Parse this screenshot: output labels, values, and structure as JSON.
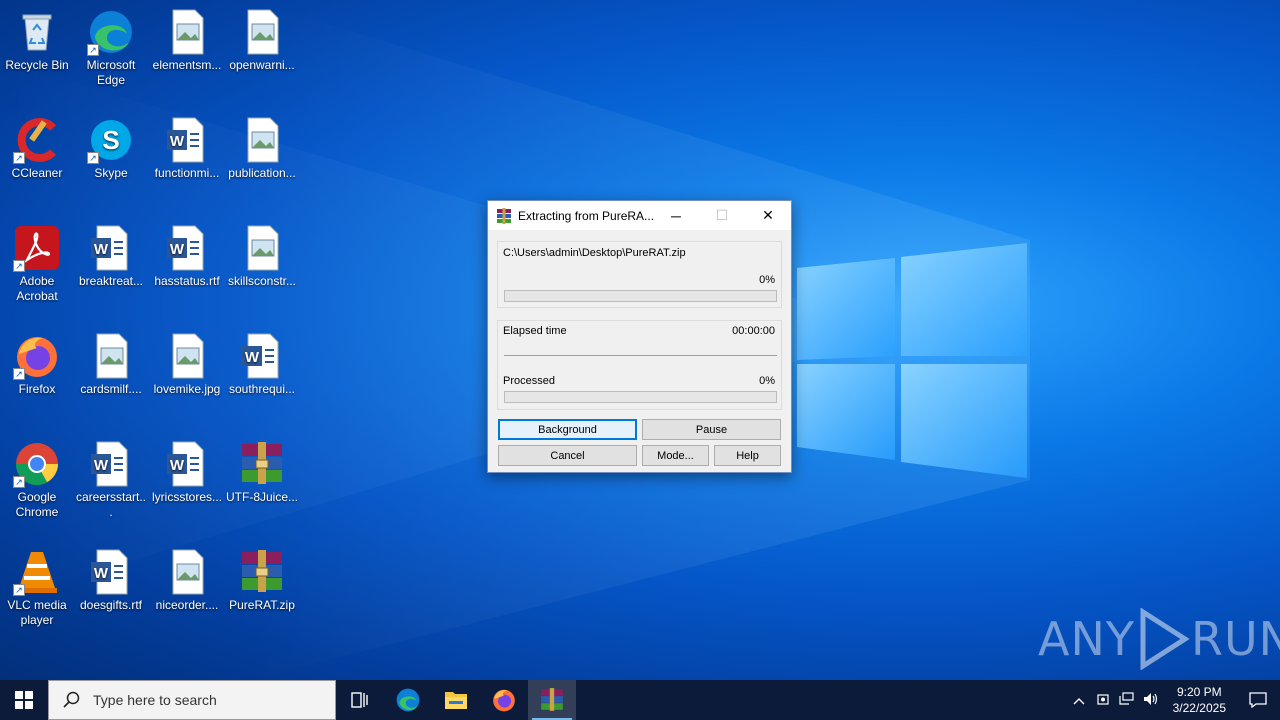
{
  "desktop": {
    "icons": [
      {
        "label": "Recycle Bin",
        "icon": "recycle-bin-icon"
      },
      {
        "label": "Microsoft Edge",
        "icon": "edge-icon"
      },
      {
        "label": "elementsm...",
        "icon": "image-file-icon"
      },
      {
        "label": "openwarni...",
        "icon": "image-file-icon"
      },
      {
        "label": "CCleaner",
        "icon": "ccleaner-icon"
      },
      {
        "label": "Skype",
        "icon": "skype-icon"
      },
      {
        "label": "functionmi...",
        "icon": "word-file-icon"
      },
      {
        "label": "publication...",
        "icon": "image-file-icon"
      },
      {
        "label": "Adobe Acrobat",
        "icon": "acrobat-icon"
      },
      {
        "label": "breaktreat...",
        "icon": "word-file-icon"
      },
      {
        "label": "hasstatus.rtf",
        "icon": "word-file-icon"
      },
      {
        "label": "skillsconstr...",
        "icon": "image-file-icon"
      },
      {
        "label": "Firefox",
        "icon": "firefox-icon"
      },
      {
        "label": "cardsmilf....",
        "icon": "image-file-icon"
      },
      {
        "label": "lovemike.jpg",
        "icon": "image-file-icon"
      },
      {
        "label": "southrequi...",
        "icon": "word-file-icon"
      },
      {
        "label": "Google Chrome",
        "icon": "chrome-icon"
      },
      {
        "label": "careersstart...",
        "icon": "word-file-icon"
      },
      {
        "label": "lyricsstores...",
        "icon": "word-file-icon"
      },
      {
        "label": "UTF-8Juice...",
        "icon": "winrar-icon"
      },
      {
        "label": "VLC media player",
        "icon": "vlc-icon"
      },
      {
        "label": "doesgifts.rtf",
        "icon": "word-file-icon"
      },
      {
        "label": "niceorder....",
        "icon": "image-file-icon"
      },
      {
        "label": "PureRAT.zip",
        "icon": "winrar-icon"
      }
    ]
  },
  "dialog": {
    "title": "Extracting from PureRA...",
    "archive_path": "C:\\Users\\admin\\Desktop\\PureRAT.zip",
    "file_percent_text": "0%",
    "file_progress": 0,
    "elapsed_label": "Elapsed time",
    "elapsed_value": "00:00:00",
    "processed_label": "Processed",
    "processed_percent_text": "0%",
    "processed_progress": 0,
    "buttons": {
      "background": "Background",
      "pause": "Pause",
      "cancel": "Cancel",
      "mode": "Mode...",
      "help": "Help"
    },
    "minimize_glyph": "─",
    "maximize_glyph": "☐",
    "close_glyph": "✕"
  },
  "watermark": {
    "text_left": "ANY",
    "text_right": "RUN"
  },
  "taskbar": {
    "search_placeholder": "Type here to search",
    "clock_time": "9:20 PM",
    "clock_date": "3/22/2025"
  },
  "colors": {
    "accent": "#0078d7",
    "progress": "#06b025",
    "taskbar": "#0d1b3a"
  }
}
